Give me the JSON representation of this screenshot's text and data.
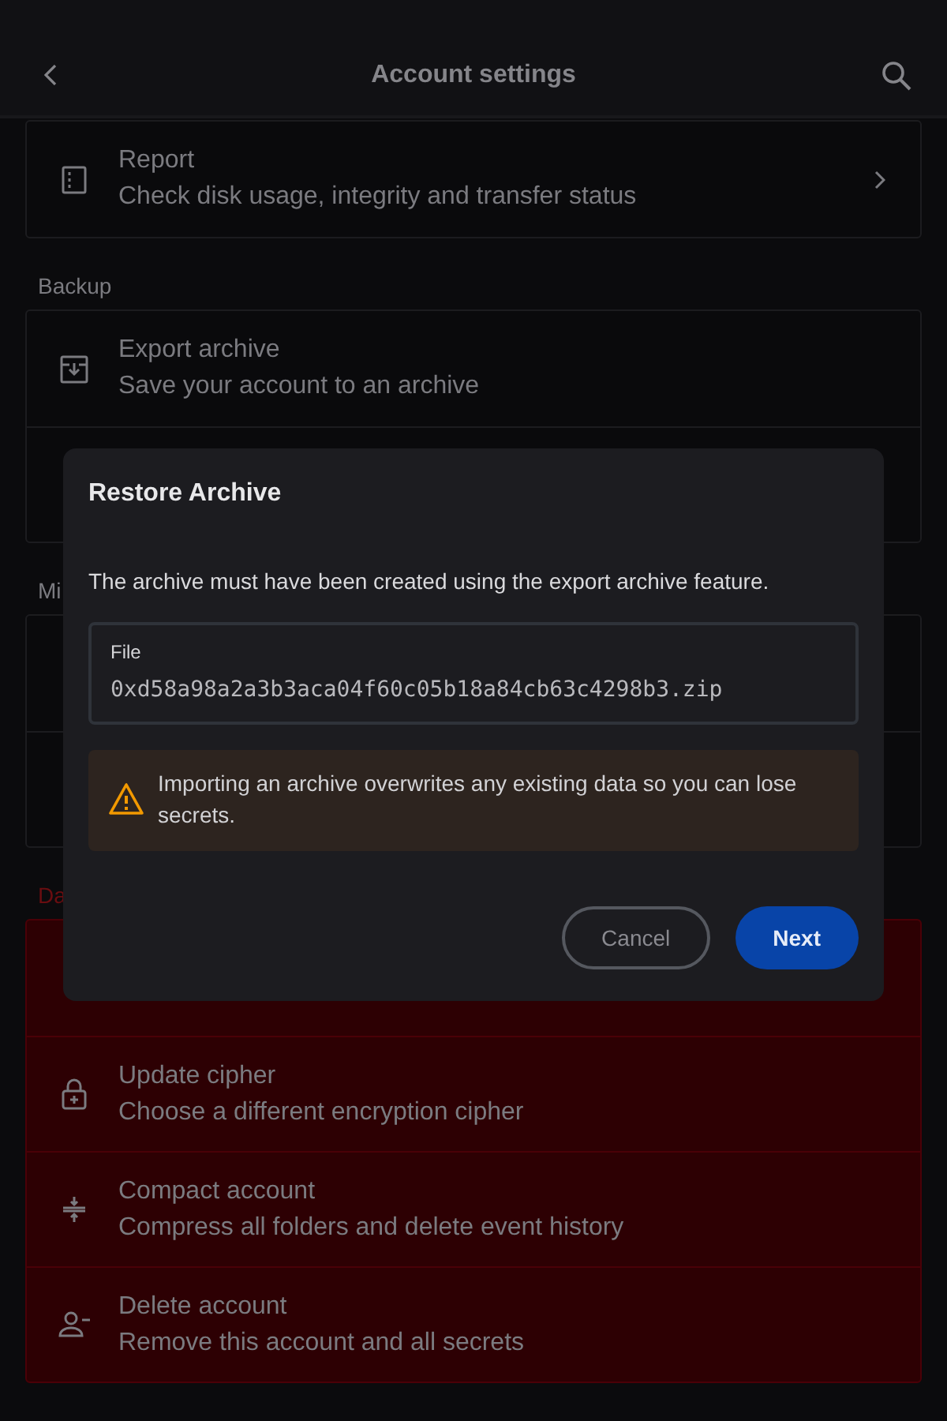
{
  "app_bar": {
    "title": "Account settings"
  },
  "sections": [
    {
      "danger": false,
      "items": [
        {
          "title": "Report",
          "subtitle": "Check disk usage, integrity and transfer status",
          "chevron": true
        }
      ]
    },
    {
      "header": "Backup",
      "danger": false,
      "items": [
        {
          "title": "Export archive",
          "subtitle": "Save your account to an archive"
        }
      ]
    },
    {
      "header": "Mi",
      "danger": false
    },
    {
      "header": "Da",
      "danger": true,
      "items": [
        {
          "title": "Update cipher",
          "subtitle": "Choose a different encryption cipher"
        },
        {
          "title": "Compact account",
          "subtitle": "Compress all folders and delete event history"
        },
        {
          "title": "Delete account",
          "subtitle": "Remove this account and all secrets"
        }
      ]
    }
  ],
  "dialog": {
    "title": "Restore Archive",
    "message": "The archive must have been created using the export archive feature.",
    "field": {
      "label": "File",
      "value": "0xd58a98a2a3b3aca04f60c05b18a84cb63c4298b3.zip"
    },
    "warning": "Importing an archive overwrites any existing data so you can lose secrets.",
    "buttons": [
      {
        "label": "Cancel",
        "kind": "outlined"
      },
      {
        "label": "Next",
        "kind": "filled"
      }
    ]
  }
}
